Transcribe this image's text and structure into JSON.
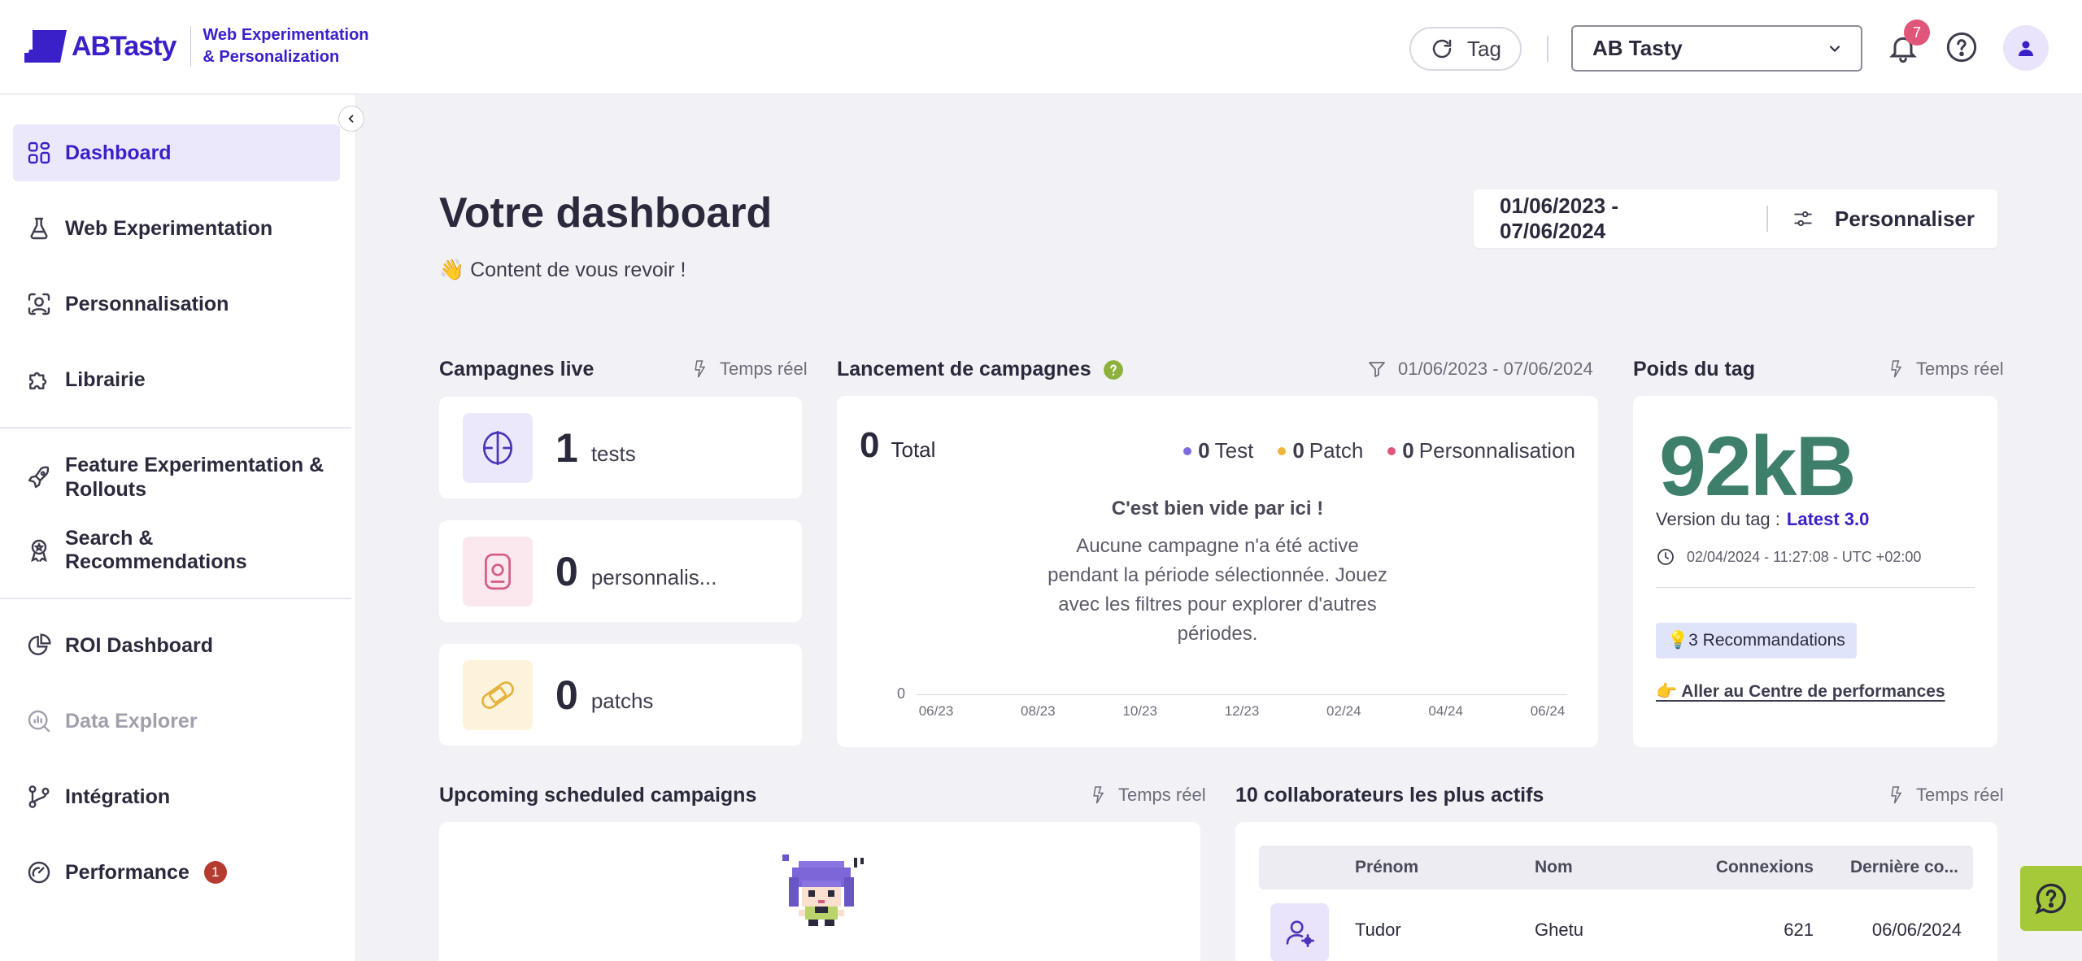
{
  "brand": {
    "name": "ABTasty",
    "subtitle_line1": "Web Experimentation",
    "subtitle_line2": "& Personalization",
    "accent": "#3a20c8"
  },
  "header": {
    "tag_label": "Tag",
    "account": "AB Tasty",
    "notifications_count": "7"
  },
  "sidebar": {
    "items": [
      {
        "label": "Dashboard",
        "icon": "dashboard-icon"
      },
      {
        "label": "Web Experimentation",
        "icon": "flask-icon"
      },
      {
        "label": "Personnalisation",
        "icon": "user-focus-icon"
      },
      {
        "label": "Librairie",
        "icon": "puzzle-icon"
      },
      {
        "label": "Feature Experimentation & Rollouts",
        "icon": "rocket-icon"
      },
      {
        "label": "Search & Recommendations",
        "icon": "award-icon"
      },
      {
        "label": "ROI Dashboard",
        "icon": "pie-chart-icon"
      },
      {
        "label": "Data Explorer",
        "icon": "data-search-icon"
      },
      {
        "label": "Intégration",
        "icon": "git-branch-icon"
      },
      {
        "label": "Performance",
        "icon": "gauge-icon",
        "badge": "1"
      }
    ]
  },
  "main": {
    "title": "Votre dashboard",
    "welcome": "👋 Content de vous revoir !",
    "date_range": "01/06/2023 - 07/06/2024",
    "customize_label": "Personnaliser"
  },
  "live_campaigns": {
    "title": "Campagnes live",
    "realtime": "Temps réel",
    "items": [
      {
        "count": "1",
        "label": "tests",
        "color": "#ece8fc"
      },
      {
        "count": "0",
        "label": "personnalis...",
        "color": "#fbe8ee"
      },
      {
        "count": "0",
        "label": "patchs",
        "color": "#fdf3dc"
      }
    ]
  },
  "launch": {
    "title": "Lancement de campagnes",
    "filter_range": "01/06/2023 - 07/06/2024",
    "total_value": "0",
    "total_label": "Total",
    "legend": [
      {
        "value": "0",
        "label": "Test",
        "color": "#7b6ce0"
      },
      {
        "value": "0",
        "label": "Patch",
        "color": "#f0b63c"
      },
      {
        "value": "0",
        "label": "Personnalisation",
        "color": "#e0567a"
      }
    ],
    "empty_title": "C'est bien vide par ici !",
    "empty_text": "Aucune campagne n'a été active pendant la période sélectionnée. Jouez avec les filtres pour explorer d'autres périodes.",
    "y_zero": "0",
    "x_ticks": [
      "06/23",
      "08/23",
      "10/23",
      "12/23",
      "02/24",
      "04/24",
      "06/24"
    ]
  },
  "tag_weight": {
    "title": "Poids du tag",
    "realtime": "Temps réel",
    "value": "92kB",
    "value_color": "#3e7f6c",
    "version_label": "Version du tag :",
    "version_value": "Latest 3.0",
    "timestamp": "02/04/2024 - 11:27:08 - UTC +02:00",
    "recommendations": "💡3 Recommandations",
    "perf_link": "👉 Aller au Centre de performances"
  },
  "upcoming": {
    "title": "Upcoming scheduled campaigns",
    "realtime": "Temps réel"
  },
  "collaborators": {
    "title": "10 collaborateurs les plus actifs",
    "realtime": "Temps réel",
    "columns": [
      "Prénom",
      "Nom",
      "Connexions",
      "Dernière co..."
    ],
    "rows": [
      {
        "first": "Tudor",
        "last": "Ghetu",
        "connections": "621",
        "last_login": "06/06/2024"
      }
    ]
  }
}
